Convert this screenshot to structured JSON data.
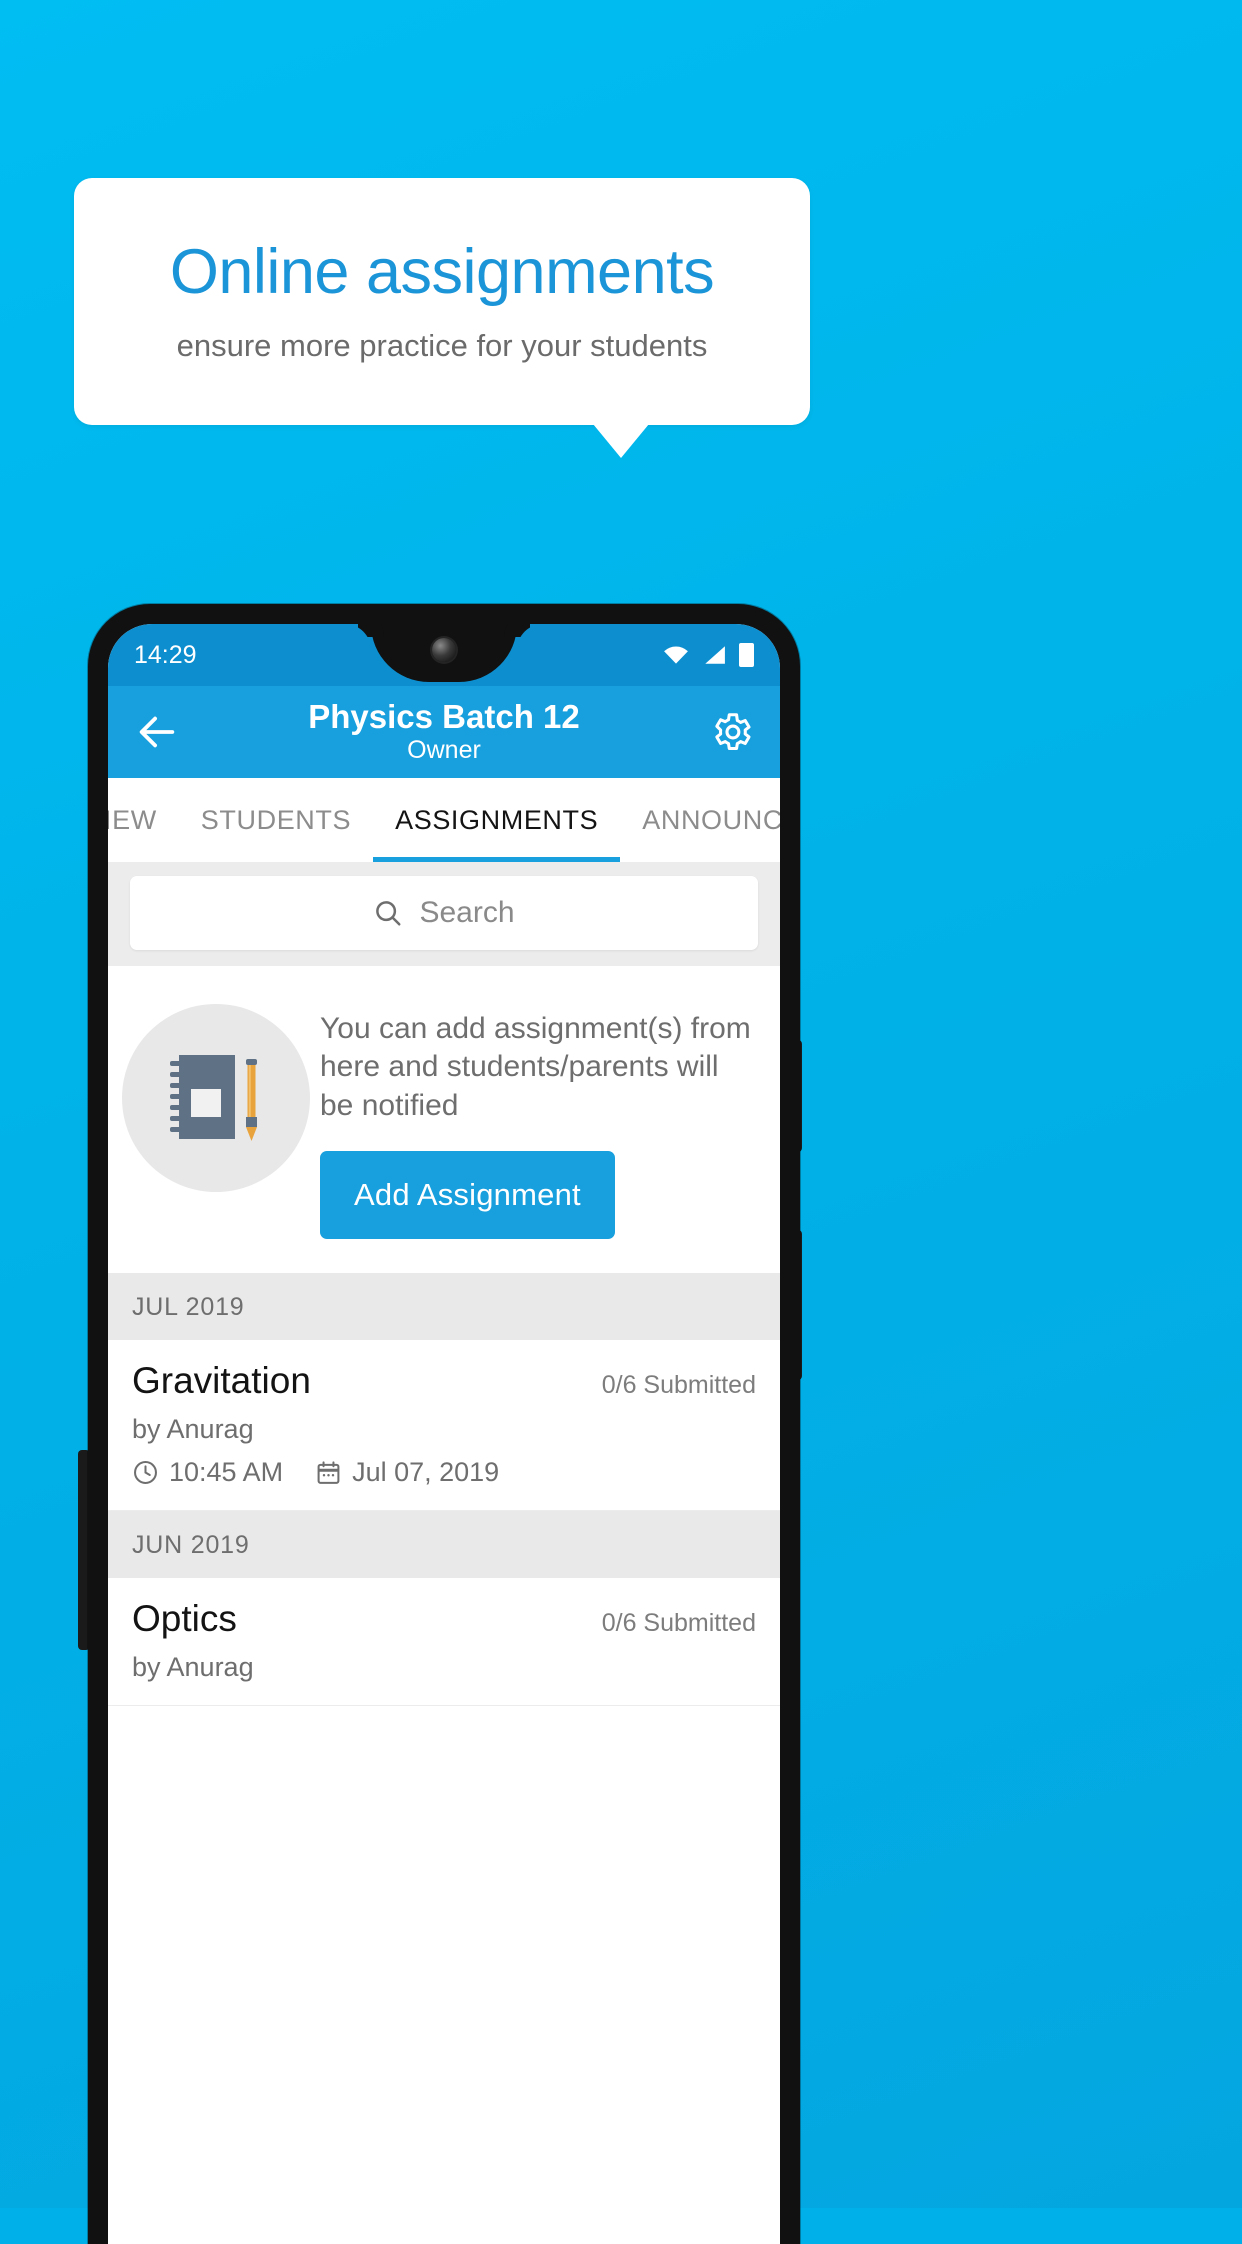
{
  "promo": {
    "title": "Online assignments",
    "subtitle": "ensure more practice for your students",
    "title_color": "#1b95d8",
    "background_color": "#00b0e8"
  },
  "statusbar": {
    "time": "14:29",
    "icons": [
      "wifi-icon",
      "signal-icon",
      "battery-icon"
    ]
  },
  "appbar": {
    "back_icon": "back-arrow-icon",
    "title": "Physics Batch 12",
    "subtitle": "Owner",
    "settings_icon": "gear-icon",
    "color": "#189fdd"
  },
  "tabs": {
    "items": [
      {
        "label": "IEW",
        "active": false
      },
      {
        "label": "STUDENTS",
        "active": false
      },
      {
        "label": "ASSIGNMENTS",
        "active": true
      },
      {
        "label": "ANNOUNCEM",
        "active": false
      }
    ],
    "indicator_color": "#189fdd"
  },
  "search": {
    "icon": "search-icon",
    "placeholder": "Search",
    "value": ""
  },
  "empty_state": {
    "illustration": "notebook-pencil-icon",
    "text": "You can add assignment(s) from here and students/parents will be notified",
    "button_label": "Add Assignment"
  },
  "list": {
    "groups": [
      {
        "month": "JUL 2019",
        "rows": [
          {
            "title": "Gravitation",
            "submitted": "0/6 Submitted",
            "author": "by Anurag",
            "time": "10:45 AM",
            "date": "Jul 07, 2019",
            "time_icon": "clock-icon",
            "date_icon": "calendar-icon"
          }
        ]
      },
      {
        "month": "JUN 2019",
        "rows": [
          {
            "title": "Optics",
            "submitted": "0/6 Submitted",
            "author": "by Anurag",
            "time": "",
            "date": "",
            "time_icon": "clock-icon",
            "date_icon": "calendar-icon"
          }
        ]
      }
    ]
  }
}
